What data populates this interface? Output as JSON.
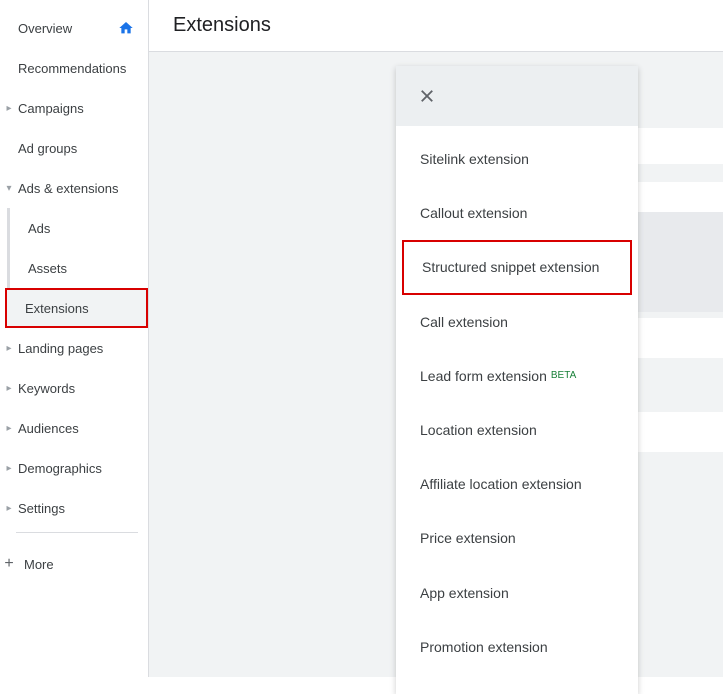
{
  "sidebar": {
    "overview": "Overview",
    "recommendations": "Recommendations",
    "campaigns": "Campaigns",
    "ad_groups": "Ad groups",
    "ads_extensions": "Ads & extensions",
    "sub_ads": "Ads",
    "sub_assets": "Assets",
    "sub_extensions": "Extensions",
    "landing_pages": "Landing pages",
    "keywords": "Keywords",
    "audiences": "Audiences",
    "demographics": "Demographics",
    "settings": "Settings",
    "more": "More"
  },
  "header": {
    "title": "Extensions"
  },
  "dropdown": {
    "items": {
      "sitelink": "Sitelink extension",
      "callout": "Callout extension",
      "structured": "Structured snippet extension",
      "call": "Call extension",
      "leadform": "Lead form extension",
      "leadform_badge": "BETA",
      "location": "Location extension",
      "affiliate": "Affiliate location extension",
      "price": "Price extension",
      "app": "App extension",
      "promotion": "Promotion extension"
    }
  }
}
